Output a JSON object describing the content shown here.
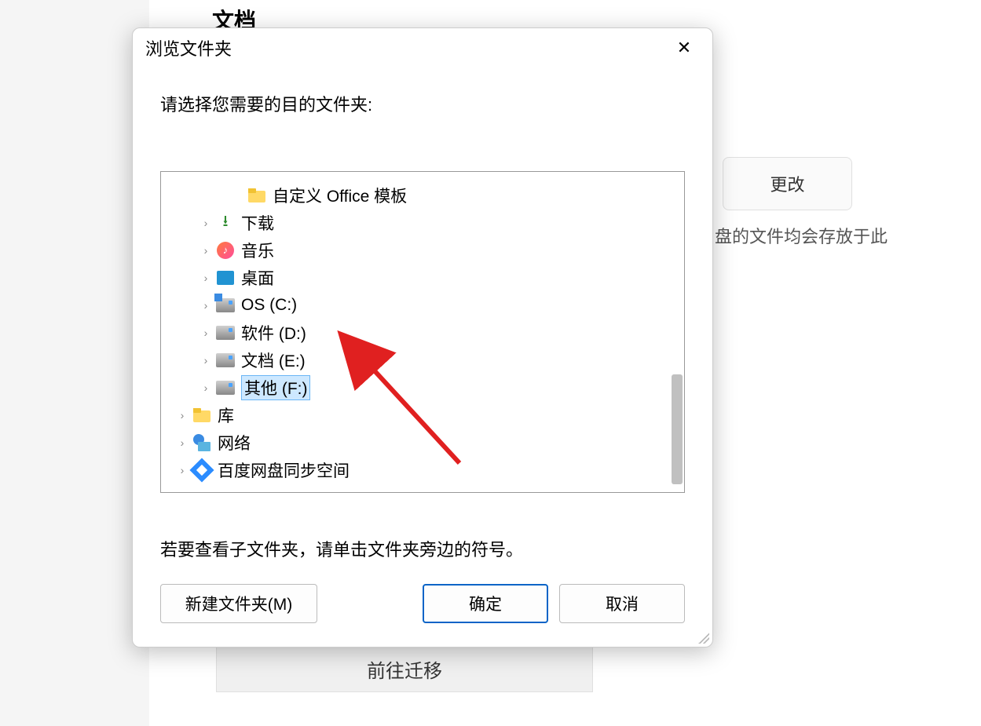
{
  "background": {
    "heading": "文档",
    "change_btn": "更改",
    "desc_fragment": "盘的文件均会存放于此",
    "migrate_btn": "前往迁移"
  },
  "dialog": {
    "title": "浏览文件夹",
    "prompt": "请选择您需要的目的文件夹:",
    "hint": "若要查看子文件夹，请单击文件夹旁边的符号。",
    "buttons": {
      "new_folder": "新建文件夹(M)",
      "ok": "确定",
      "cancel": "取消"
    }
  },
  "tree": {
    "items": [
      {
        "label": "自定义 Office 模板",
        "indent": 2,
        "icon": "folder",
        "expander": "none",
        "selected": false
      },
      {
        "label": "下载",
        "indent": 1,
        "icon": "download",
        "expander": "closed",
        "selected": false
      },
      {
        "label": "音乐",
        "indent": 1,
        "icon": "music",
        "expander": "closed",
        "selected": false
      },
      {
        "label": "桌面",
        "indent": 1,
        "icon": "desktop",
        "expander": "closed",
        "selected": false
      },
      {
        "label": "OS (C:)",
        "indent": 1,
        "icon": "drive-os",
        "expander": "closed",
        "selected": false
      },
      {
        "label": "软件 (D:)",
        "indent": 1,
        "icon": "drive",
        "expander": "closed",
        "selected": false
      },
      {
        "label": "文档 (E:)",
        "indent": 1,
        "icon": "drive",
        "expander": "closed",
        "selected": false
      },
      {
        "label": "其他 (F:)",
        "indent": 1,
        "icon": "drive",
        "expander": "closed",
        "selected": true
      },
      {
        "label": "库",
        "indent": 0,
        "icon": "library",
        "expander": "closed",
        "selected": false
      },
      {
        "label": "网络",
        "indent": 0,
        "icon": "network",
        "expander": "closed",
        "selected": false
      },
      {
        "label": "百度网盘同步空间",
        "indent": 0,
        "icon": "baidu",
        "expander": "closed",
        "selected": false
      }
    ]
  }
}
